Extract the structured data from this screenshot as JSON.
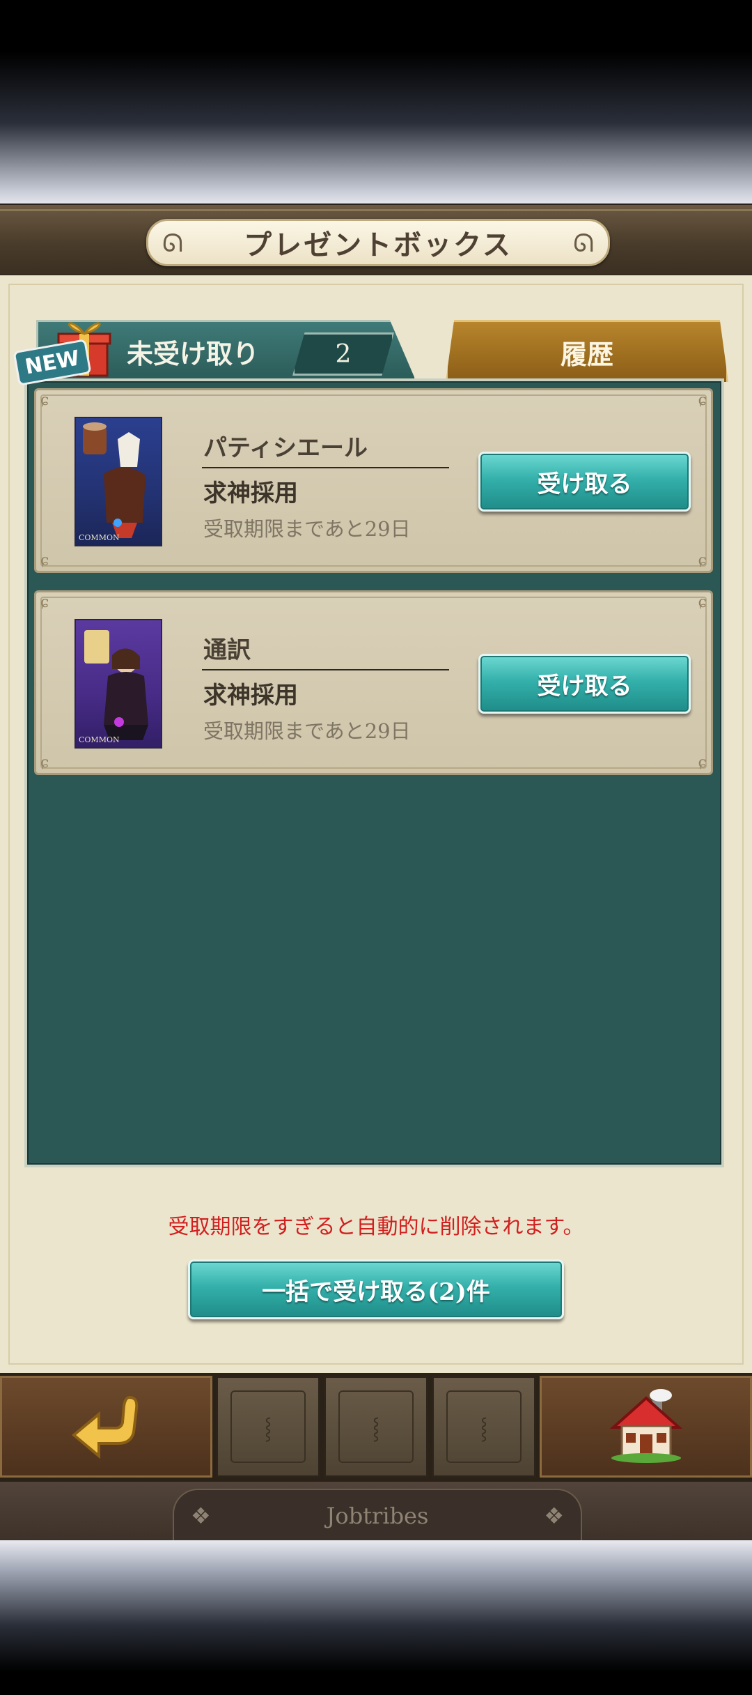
{
  "header": {
    "title": "プレゼントボックス"
  },
  "tabs": {
    "unreceived": {
      "badge": "NEW",
      "label": "未受け取り",
      "count": "2"
    },
    "history": {
      "label": "履歴"
    }
  },
  "presents": [
    {
      "name": "パティシエール",
      "type": "求神採用",
      "deadline": "受取期限まであと29日",
      "button": "受け取る",
      "rarity": "COMMON"
    },
    {
      "name": "通訳",
      "type": "求神採用",
      "deadline": "受取期限まであと29日",
      "button": "受け取る",
      "rarity": "COMMON"
    }
  ],
  "notice": "受取期限をすぎると自動的に削除されます。",
  "bulk_button": "一括で受け取る(2)件",
  "footer": {
    "brand": "Jobtribes"
  },
  "colors": {
    "accent_teal": "#34b0ab",
    "notice_red": "#d11f1f",
    "panel_teal": "#2b5755"
  }
}
